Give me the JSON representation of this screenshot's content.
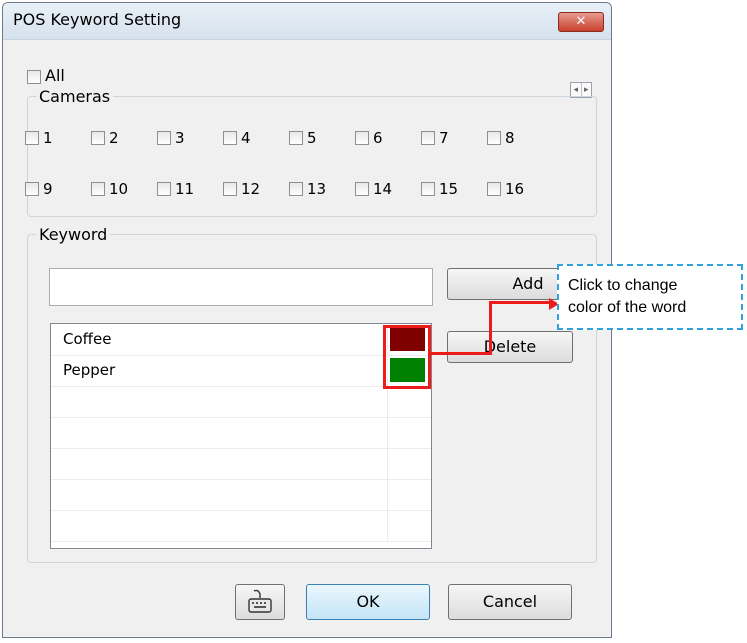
{
  "window": {
    "title": "POS Keyword Setting",
    "close_label": "✕"
  },
  "all_checkbox": {
    "label": "All",
    "checked": false
  },
  "scroll_arrows": {
    "left": "◂",
    "right": "▸"
  },
  "cameras": {
    "legend": "Cameras",
    "rows": [
      [
        "1",
        "2",
        "3",
        "4",
        "5",
        "6",
        "7",
        "8"
      ],
      [
        "9",
        "10",
        "11",
        "12",
        "13",
        "14",
        "15",
        "16"
      ]
    ]
  },
  "keyword": {
    "legend": "Keyword",
    "input_value": "",
    "add_label": "Add",
    "delete_label": "Delete",
    "items": [
      {
        "word": "Coffee",
        "color": "#800000"
      },
      {
        "word": "Pepper",
        "color": "#008000"
      }
    ],
    "empty_rows": 5
  },
  "footer": {
    "ok_label": "OK",
    "cancel_label": "Cancel",
    "keyboard_icon": "keyboard-icon"
  },
  "callout": {
    "line1": "Click to change",
    "line2": "color of the word"
  },
  "colors": {
    "annotation_red": "#ee1b1b",
    "callout_border": "#2fa0e0"
  }
}
